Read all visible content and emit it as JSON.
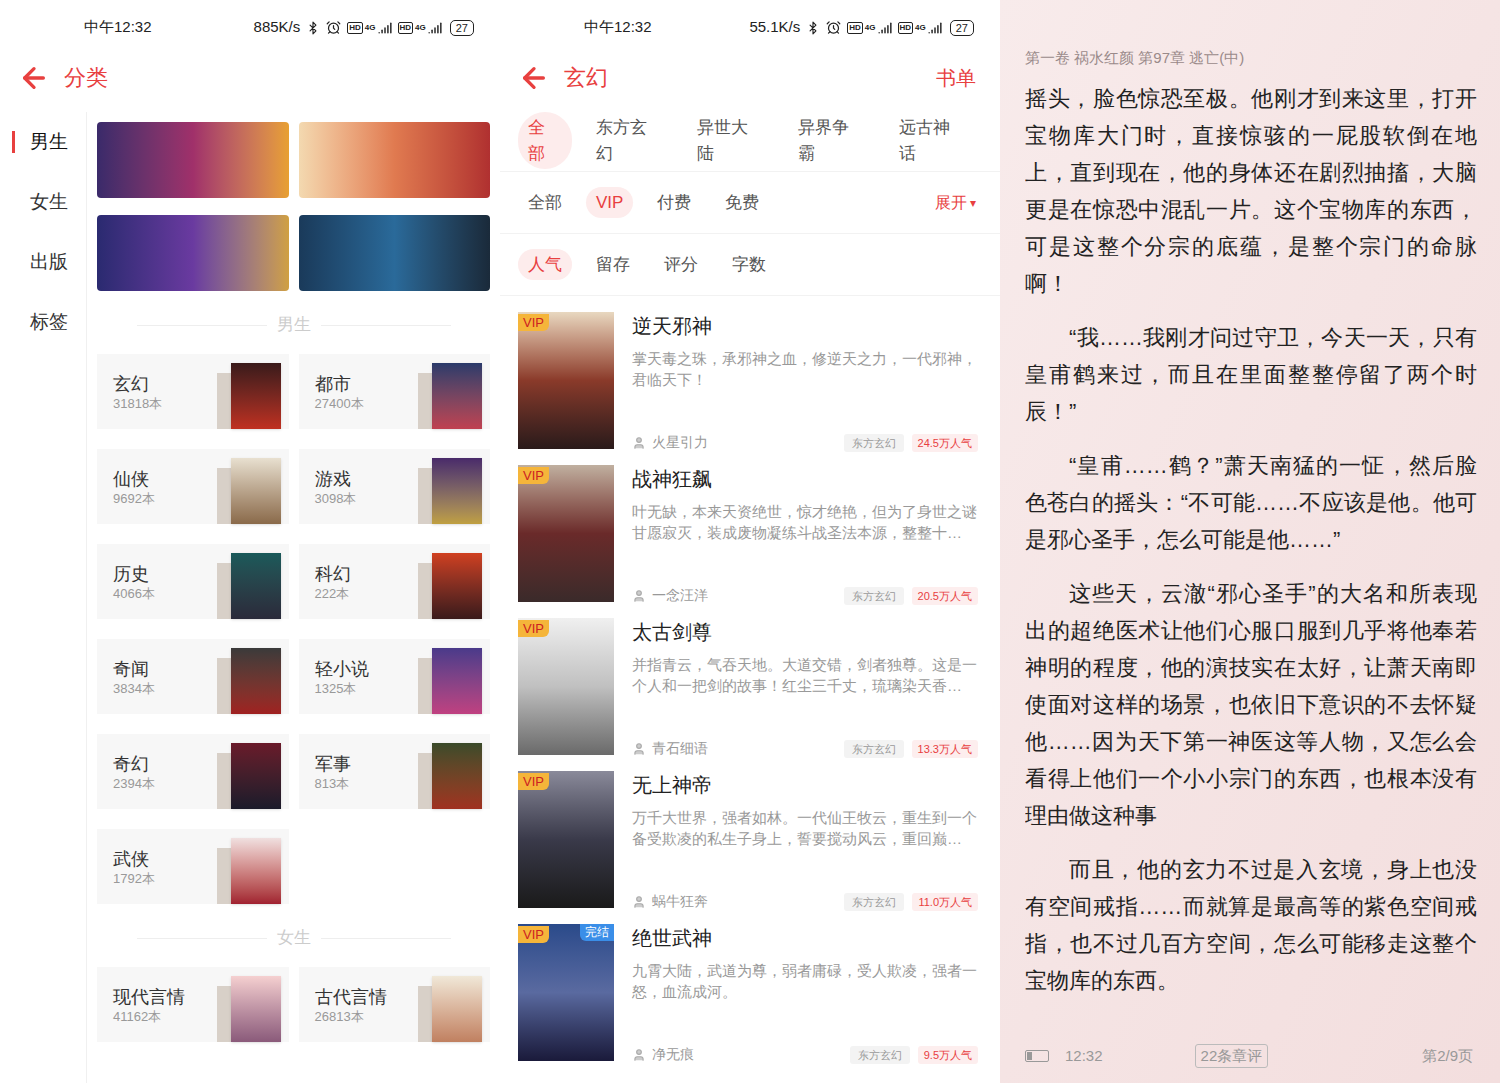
{
  "category_screen": {
    "status_bar": {
      "time": "中午12:32",
      "speed": "885K/s",
      "sims": [
        {
          "hd": "HD",
          "net": "4G"
        },
        {
          "hd": "HD",
          "net": "4G"
        }
      ],
      "battery": "27"
    },
    "header": {
      "title": "分类"
    },
    "sidebar": [
      {
        "label": "男生",
        "selected": true
      },
      {
        "label": "女生",
        "selected": false
      },
      {
        "label": "出版",
        "selected": false
      },
      {
        "label": "标签",
        "selected": false
      }
    ],
    "sections": [
      {
        "title": "男生",
        "categories": [
          {
            "name": "玄幻",
            "count": "31818本"
          },
          {
            "name": "都市",
            "count": "27400本"
          },
          {
            "name": "仙侠",
            "count": "9692本"
          },
          {
            "name": "游戏",
            "count": "3098本"
          },
          {
            "name": "历史",
            "count": "4066本"
          },
          {
            "name": "科幻",
            "count": "222本"
          },
          {
            "name": "奇闻",
            "count": "3834本"
          },
          {
            "name": "轻小说",
            "count": "1325本"
          },
          {
            "name": "奇幻",
            "count": "2394本"
          },
          {
            "name": "军事",
            "count": "813本"
          },
          {
            "name": "武侠",
            "count": "1792本"
          }
        ]
      },
      {
        "title": "女生",
        "categories": [
          {
            "name": "现代言情",
            "count": "41162本"
          },
          {
            "name": "古代言情",
            "count": "26813本"
          }
        ]
      }
    ]
  },
  "list_screen": {
    "status_bar": {
      "time": "中午12:32",
      "speed": "55.1K/s",
      "sims": [
        {
          "hd": "HD",
          "net": "4G"
        },
        {
          "hd": "HD",
          "net": "4G"
        }
      ],
      "battery": "27"
    },
    "header": {
      "title": "玄幻",
      "action": "书单"
    },
    "filter_rows": [
      {
        "options": [
          {
            "label": "全部",
            "selected": true
          },
          {
            "label": "东方玄幻",
            "selected": false
          },
          {
            "label": "异世大陆",
            "selected": false
          },
          {
            "label": "异界争霸",
            "selected": false
          },
          {
            "label": "远古神话",
            "selected": false
          }
        ],
        "expand": null
      },
      {
        "options": [
          {
            "label": "全部",
            "selected": false
          },
          {
            "label": "VIP",
            "selected": true
          },
          {
            "label": "付费",
            "selected": false
          },
          {
            "label": "免费",
            "selected": false
          }
        ],
        "expand": {
          "label": "展开",
          "icon": "▾"
        }
      },
      {
        "options": [
          {
            "label": "人气",
            "selected": true
          },
          {
            "label": "留存",
            "selected": false
          },
          {
            "label": "评分",
            "selected": false
          },
          {
            "label": "字数",
            "selected": false
          }
        ],
        "expand": null
      }
    ],
    "books": [
      {
        "title": "逆天邪神",
        "desc": "掌天毒之珠，承邪神之血，修逆天之力，一代邪神，君临天下！",
        "author": "火星引力",
        "tag": "东方玄幻",
        "popularity": "24.5万人气",
        "badges": [
          "VIP"
        ]
      },
      {
        "title": "战神狂飙",
        "desc": "叶无缺，本来天资绝世，惊才绝艳，但为了身世之谜甘愿寂灭，装成废物凝练斗战圣法本源，整整十…",
        "author": "一念汪洋",
        "tag": "东方玄幻",
        "popularity": "20.5万人气",
        "badges": [
          "VIP"
        ]
      },
      {
        "title": "太古剑尊",
        "desc": "并指青云，气吞天地。大道交错，剑者独尊。这是一个人和一把剑的故事！红尘三千丈，琉璃染天香…",
        "author": "青石细语",
        "tag": "东方玄幻",
        "popularity": "13.3万人气",
        "badges": [
          "VIP"
        ]
      },
      {
        "title": "无上神帝",
        "desc": "万千大世界，强者如林。一代仙王牧云，重生到一个备受欺凌的私生子身上，誓要搅动风云，重回巅…",
        "author": "蜗牛狂奔",
        "tag": "东方玄幻",
        "popularity": "11.0万人气",
        "badges": [
          "VIP"
        ]
      },
      {
        "title": "绝世武神",
        "desc": "九霄大陆，武道为尊，弱者庸碌，受人欺凌，强者一怒，血流成河。",
        "author": "净无痕",
        "tag": "东方玄幻",
        "popularity": "9.5万人气",
        "badges": [
          "VIP",
          "完结"
        ]
      }
    ]
  },
  "reader_screen": {
    "chapter": "第一卷 祸水红颜 第97章 逃亡(中)",
    "paragraphs": [
      {
        "text": "摇头，脸色惊恐至极。他刚才到来这里，打开宝物库大门时，直接惊骇的一屁股软倒在地上，直到现在，他的身体还在剧烈抽搐，大脑更是在惊恐中混乱一片。这个宝物库的东西，可是这整个分宗的底蕴，是整个宗门的命脉啊！",
        "indent": false
      },
      {
        "text": "“我……我刚才问过守卫，今天一天，只有皇甫鹤来过，而且在里面整整停留了两个时辰！”",
        "indent": true
      },
      {
        "text": "“皇甫……鹤？”萧天南猛的一怔，然后脸色苍白的摇头：“不可能……不应该是他。他可是邪心圣手，怎么可能是他……”",
        "indent": true
      },
      {
        "text": "这些天，云澈“邪心圣手”的大名和所表现出的超绝医术让他们心服口服到几乎将他奉若神明的程度，他的演技实在太好，让萧天南即使面对这样的场景，也依旧下意识的不去怀疑他……因为天下第一神医这等人物，又怎么会看得上他们一个小小宗门的东西，也根本没有理由做这种事",
        "indent": true
      },
      {
        "text": "而且，他的玄力不过是入玄境，身上也没有空间戒指……而就算是最高等的紫色空间戒指，也不过几百方空间，怎么可能移走这整个宝物库的东西。",
        "indent": true
      }
    ],
    "footer": {
      "battery_level": 0.27,
      "time": "12:32",
      "comments": "22条章评",
      "page": "第2/9页"
    }
  }
}
